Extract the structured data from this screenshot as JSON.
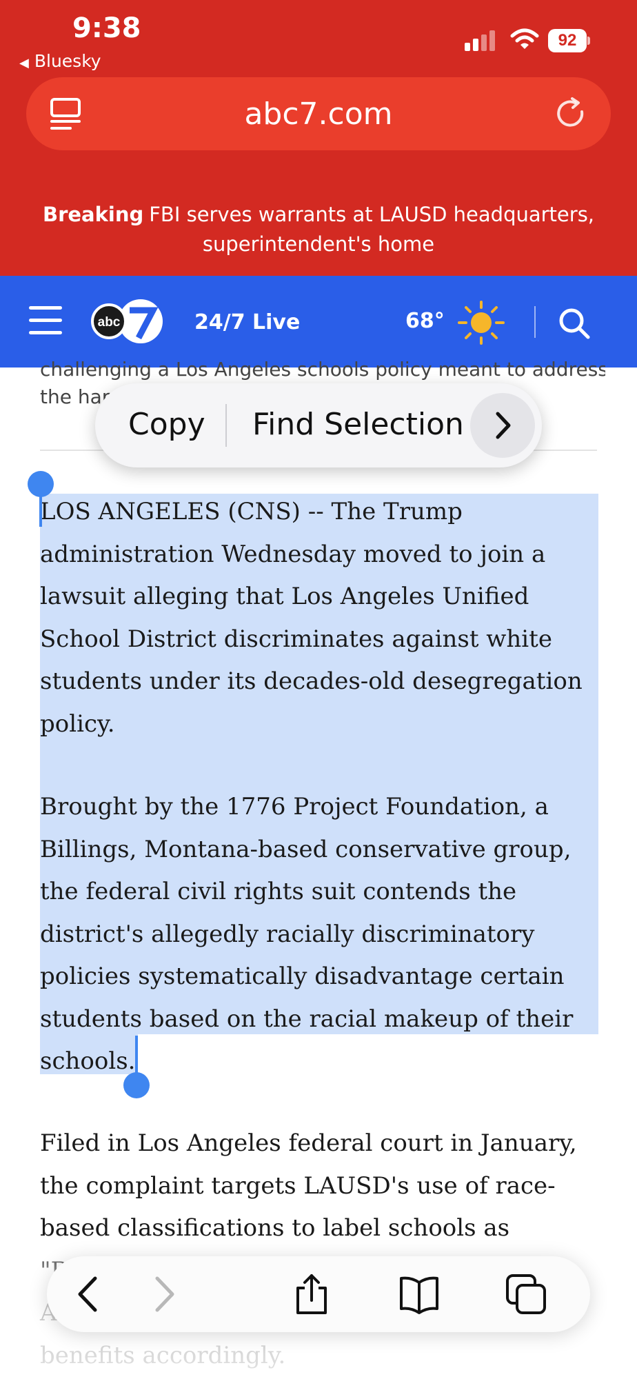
{
  "status_bar": {
    "time": "9:38",
    "back_app": "Bluesky",
    "battery": "92",
    "icons": [
      "cellular-signal-icon",
      "wifi-icon",
      "battery-icon"
    ]
  },
  "browser": {
    "url": "abc7.com",
    "icons": [
      "reader-mode-icon",
      "reload-icon"
    ]
  },
  "breaking": {
    "label": "Breaking",
    "text": "FBI serves warrants at LAUSD headquarters, superintendent's home"
  },
  "site_nav": {
    "logo": "abc",
    "live": "24/7 Live",
    "temperature": "68°",
    "icons": [
      "menu-icon",
      "sun-icon",
      "search-icon"
    ]
  },
  "article": {
    "previous_text": [
      "challenging a Los Angeles schools policy meant to address",
      "the har                   n or segregation."
    ],
    "p1": "LOS ANGELES (CNS) -- The Trump administration Wednesday moved to join a lawsuit alleging that Los Angeles Unified School District discriminates against white students under its decades-old desegregation policy.",
    "p2": "Brought by the 1776 Project Foundation, a Billings, Montana-based conservative group, the federal civil rights suit contends the district's allegedly racially discriminatory policies systematically disadvantage certain students based on the racial makeup of their schools.",
    "p3": "Filed in Los Angeles federal court in January, the complaint targets LAUSD's use of race-based classifications to label schools as \"Racially   Predominantly Hispanic, Black, Asian and Other non-Anglo\" -- and to allocate benefits accordingly."
  },
  "selection_menu": {
    "copy": "Copy",
    "find_selection": "Find Selection"
  },
  "toolbar": {
    "items": [
      "back-icon",
      "forward-icon",
      "share-icon",
      "bookmarks-icon",
      "tabs-icon"
    ]
  },
  "colors": {
    "status_red": "#d32a22",
    "url_bar_red": "#ea3e2c",
    "nav_blue": "#2a5ee8",
    "selection_blue": "#cfe0fa",
    "handle_blue": "#3f86f0",
    "sun_yellow": "#f6b62a"
  }
}
